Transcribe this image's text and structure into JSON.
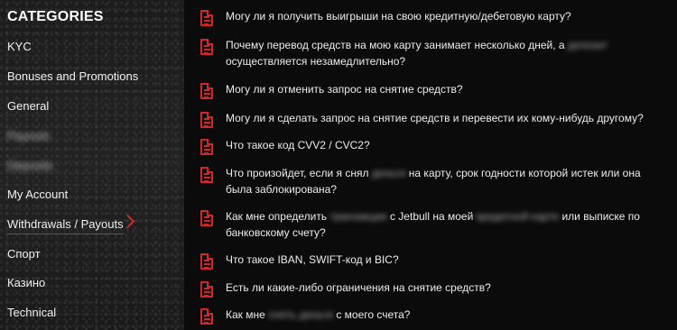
{
  "sidebar": {
    "title": "CATEGORIES",
    "items": [
      {
        "label": "KYC"
      },
      {
        "label": "Bonuses and Promotions"
      },
      {
        "label": "General"
      },
      {
        "label": "Payouts"
      },
      {
        "label": "Deposits"
      },
      {
        "label": "My Account"
      },
      {
        "label": "Withdrawals / Payouts"
      },
      {
        "label": "Спорт"
      },
      {
        "label": "Казино"
      },
      {
        "label": "Technical"
      }
    ]
  },
  "questions": [
    {
      "parts": [
        "Могу ли я получить выигрыши на свою кредитную/дебетовую карту?"
      ]
    },
    {
      "parts": [
        "Почему перевод средств на мою карту занимает несколько дней, а ",
        "депозит",
        " осуществляется незамедлительно?"
      ]
    },
    {
      "parts": [
        "Могу ли я отменить запрос на снятие средств?"
      ]
    },
    {
      "parts": [
        "Могу ли я сделать запрос на снятие средств и перевести их кому-нибудь другому?"
      ]
    },
    {
      "parts": [
        "Что такое код CVV2 / CVC2?"
      ]
    },
    {
      "parts": [
        "Что произойдет, если я снял ",
        "деньги",
        " на карту, срок годности которой истек или она была заблокирована?"
      ]
    },
    {
      "parts": [
        "Как мне определить ",
        "транзакции",
        " с Jetbull на моей ",
        "кредитной карте",
        " или выписке по банковскому счету?"
      ]
    },
    {
      "parts": [
        "Что такое IBAN, SWIFT-код и BIC?"
      ]
    },
    {
      "parts": [
        "Есть ли какие-либо ограничения на снятие средств?"
      ]
    },
    {
      "parts": [
        "Как мне ",
        "снять деньги",
        " с моего счета?"
      ]
    }
  ],
  "icons": {
    "question": "document-icon",
    "active_chevron": "chevron-right-icon"
  },
  "colors": {
    "accent": "#d3262a",
    "background": "#0b0b0b",
    "text": "#ececec"
  }
}
